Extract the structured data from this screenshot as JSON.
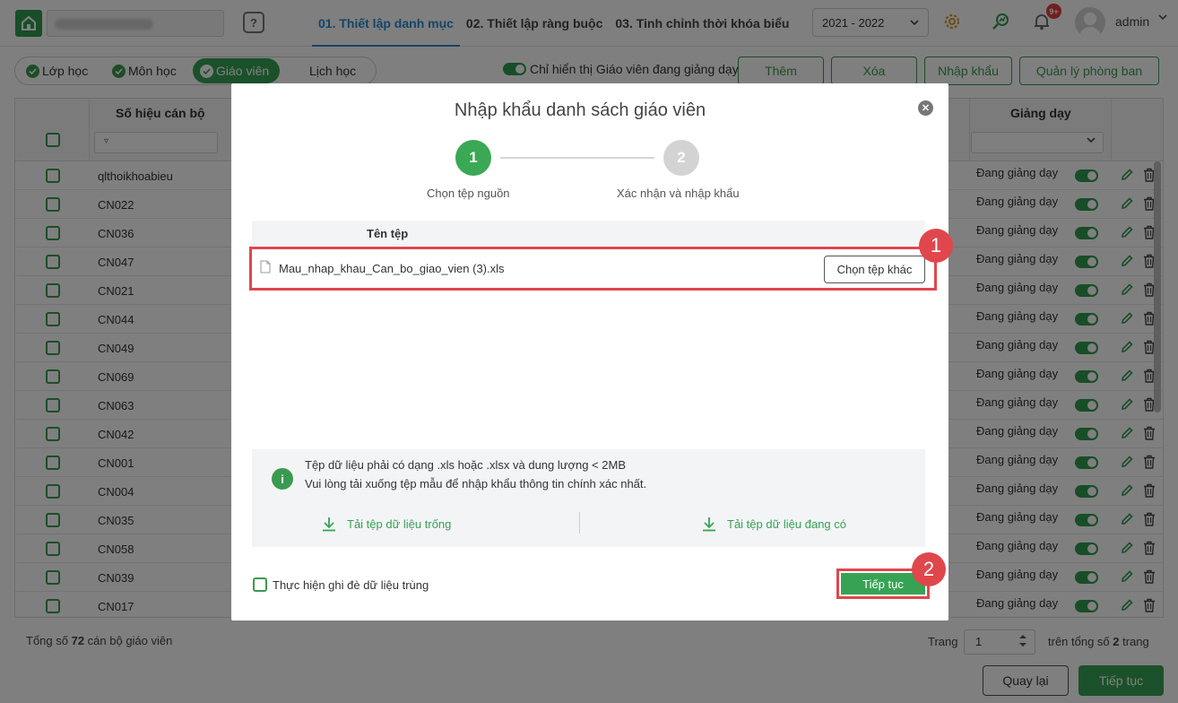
{
  "header": {
    "tabs": [
      {
        "label": "01. Thiết lập danh mục",
        "active": true
      },
      {
        "label": "02. Thiết lập ràng buộc",
        "active": false
      },
      {
        "label": "03. Tinh chỉnh thời khóa biểu",
        "active": false
      }
    ],
    "school_year": "2021 - 2022",
    "notification_badge": "9+",
    "user_name": "admin",
    "help_icon": "question-icon",
    "settings_icon": "gear-icon",
    "chart_icon": "trend-icon",
    "bell_icon": "bell-icon"
  },
  "filters": {
    "chips": [
      {
        "label": "Lớp học",
        "checked": true,
        "active": false
      },
      {
        "label": "Môn học",
        "checked": true,
        "active": false
      },
      {
        "label": "Giáo viên",
        "checked": true,
        "active": true
      },
      {
        "label": "Lịch học",
        "checked": false,
        "active": false
      }
    ],
    "toggle_label": "Chỉ hiển thị Giáo viên đang giảng dạy",
    "actions": [
      "Thêm",
      "Xóa",
      "Nhập khẩu",
      "Quản lý phòng ban"
    ]
  },
  "table": {
    "col_code_header": "Số hiệu cán bộ",
    "col_status_header": "Giảng dạy",
    "rows": [
      {
        "code": "qlthoikhoabieu",
        "status": "Đang giảng dạy"
      },
      {
        "code": "CN022",
        "status": "Đang giảng dạy"
      },
      {
        "code": "CN036",
        "status": "Đang giảng dạy"
      },
      {
        "code": "CN047",
        "status": "Đang giảng dạy"
      },
      {
        "code": "CN021",
        "status": "Đang giảng dạy"
      },
      {
        "code": "CN044",
        "status": "Đang giảng dạy"
      },
      {
        "code": "CN049",
        "status": "Đang giảng dạy"
      },
      {
        "code": "CN069",
        "status": "Đang giảng dạy"
      },
      {
        "code": "CN063",
        "status": "Đang giảng dạy"
      },
      {
        "code": "CN042",
        "status": "Đang giảng dạy"
      },
      {
        "code": "CN001",
        "status": "Đang giảng dạy"
      },
      {
        "code": "CN004",
        "status": "Đang giảng dạy"
      },
      {
        "code": "CN035",
        "status": "Đang giảng dạy"
      },
      {
        "code": "CN058",
        "status": "Đang giảng dạy"
      },
      {
        "code": "CN039",
        "status": "Đang giảng dạy"
      },
      {
        "code": "CN017",
        "status": "Đang giảng dạy"
      }
    ]
  },
  "footer": {
    "total_prefix": "Tổng số ",
    "total_count": "72",
    "total_suffix": " cán bộ giáo viên",
    "page_label": "Trang",
    "page_value": "1",
    "page_total_prefix": "trên tổng số ",
    "page_total_count": "2",
    "page_total_suffix": " trang",
    "back_label": "Quay lại",
    "next_label": "Tiếp tục"
  },
  "modal": {
    "title": "Nhập khẩu danh sách giáo viên",
    "steps": [
      {
        "number": "1",
        "label": "Chọn tệp nguồn",
        "active": true
      },
      {
        "number": "2",
        "label": "Xác nhận và nhập khẩu",
        "active": false
      }
    ],
    "file_header": "Tên tệp",
    "file_name": "Mau_nhap_khau_Can_bo_giao_vien (3).xls",
    "choose_label": "Chọn tệp khác",
    "info_line1": "Tệp dữ liệu phải có dạng .xls hoặc .xlsx và dung lượng < 2MB",
    "info_line2": "Vui lòng tải xuống tệp mẫu để nhập khẩu thông tin chính xác nhất.",
    "download_empty": "Tải tệp dữ liệu trống",
    "download_existing": "Tải tệp dữ liệu đang có",
    "overwrite_label": "Thực hiện ghi đè dữ liệu trùng",
    "continue_label": "Tiếp tục"
  },
  "annotations": {
    "marker1": "1",
    "marker2": "2"
  },
  "colors": {
    "primary_green": "#36a354",
    "accent_blue": "#2a8bd1",
    "highlight_red": "#e0474c"
  }
}
